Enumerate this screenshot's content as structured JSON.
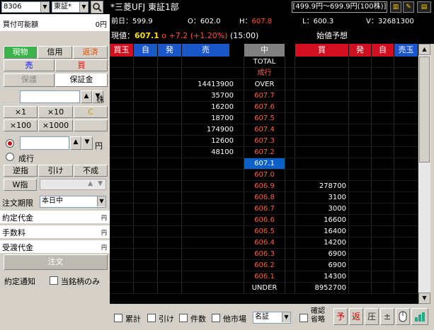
{
  "topbar": {
    "code": "8306",
    "market": "東証*",
    "stock_title": "*三菱UFJ 東証1部",
    "price_range": "[499.9円〜699.9円(100株)]"
  },
  "info": {
    "prev_label": "前日：",
    "prev": "599.9",
    "open_label": "O：",
    "open": "602.0",
    "high_label": "H：",
    "high": "607.8",
    "low_label": "L：",
    "low": "600.3",
    "vol_label": "V：",
    "vol": "32681300",
    "cur_label": "現値：",
    "cur": "607.1",
    "cur_mark": "o",
    "change": "+7.2 (+1.20%)",
    "time": "(15:00)",
    "forecast": "始値予想"
  },
  "left": {
    "buying_power_label": "買付可能額",
    "buying_power": "0円",
    "tab_genbutsu": "現物",
    "tab_shinyo": "信用",
    "tab_hensai": "返済",
    "sell": "売",
    "buy": "買",
    "hogo": "保護",
    "hoshokin": "保証金",
    "qty_unit": "株",
    "mult": [
      "×1",
      "×10",
      "C",
      "×100",
      "×1000"
    ],
    "yen_unit": "円",
    "nariyuki": "成行",
    "gyakusashi": "逆指",
    "hike": "引け",
    "funari": "不成",
    "wsashi": "W指",
    "period_label": "注文期限",
    "period_value": "本日中",
    "yakutei_label": "約定代金",
    "tesuryo_label": "手数料",
    "ukewatashi_label": "受渡代金",
    "yen": "円",
    "order_button": "注文",
    "notify_label": "約定通知",
    "this_only_label": "当銘柄のみ"
  },
  "board": {
    "headers": [
      "買玉",
      "自",
      "発",
      "売",
      "中",
      "買",
      "発",
      "自",
      "売玉"
    ],
    "rows": [
      {
        "sell": "",
        "price": "TOTAL",
        "buy": "",
        "ptype": "label"
      },
      {
        "sell": "",
        "price": "成行",
        "buy": "",
        "ptype": "ask"
      },
      {
        "sell": "14413900",
        "price": "OVER",
        "buy": "",
        "ptype": "label"
      },
      {
        "sell": "35700",
        "price": "607.7",
        "buy": "",
        "ptype": "ask"
      },
      {
        "sell": "16200",
        "price": "607.6",
        "buy": "",
        "ptype": "ask"
      },
      {
        "sell": "18700",
        "price": "607.5",
        "buy": "",
        "ptype": "ask"
      },
      {
        "sell": "174900",
        "price": "607.4",
        "buy": "",
        "ptype": "ask"
      },
      {
        "sell": "12600",
        "price": "607.3",
        "buy": "",
        "ptype": "ask"
      },
      {
        "sell": "48100",
        "price": "607.2",
        "buy": "",
        "ptype": "ask"
      },
      {
        "sell": "",
        "price": "607.1",
        "buy": "",
        "ptype": "current"
      },
      {
        "sell": "",
        "price": "607.0",
        "buy": "",
        "ptype": "ask"
      },
      {
        "sell": "",
        "price": "606.9",
        "buy": "278700",
        "ptype": "bid"
      },
      {
        "sell": "",
        "price": "606.8",
        "buy": "3100",
        "ptype": "bid"
      },
      {
        "sell": "",
        "price": "606.7",
        "buy": "3000",
        "ptype": "bid"
      },
      {
        "sell": "",
        "price": "606.6",
        "buy": "16600",
        "ptype": "bid"
      },
      {
        "sell": "",
        "price": "606.5",
        "buy": "16400",
        "ptype": "bid"
      },
      {
        "sell": "",
        "price": "606.4",
        "buy": "14200",
        "ptype": "bid"
      },
      {
        "sell": "",
        "price": "606.3",
        "buy": "6900",
        "ptype": "bid"
      },
      {
        "sell": "",
        "price": "606.2",
        "buy": "6900",
        "ptype": "bid"
      },
      {
        "sell": "",
        "price": "606.1",
        "buy": "14300",
        "ptype": "bid"
      },
      {
        "sell": "",
        "price": "UNDER",
        "buy": "8952700",
        "ptype": "label"
      }
    ]
  },
  "bottom": {
    "ruikei": "累計",
    "hike": "引け",
    "kensu": "件数",
    "tashijo": "他市場",
    "market_select": "名証",
    "kakunin": "確認",
    "shoryaku": "省略",
    "icons": [
      "予",
      "返",
      "圧",
      "±"
    ]
  },
  "colors": {
    "sell_header": "#d01020",
    "buy_header": "#d01020",
    "blue_header": "#1a56c8",
    "ask_price": "#ff6040",
    "bid_price": "#ff6040",
    "current_bg": "#0a5fc8",
    "tab_green": "#3cb34a",
    "sell_btn_text": "#0000ff",
    "buy_btn_text": "#ff0000"
  }
}
